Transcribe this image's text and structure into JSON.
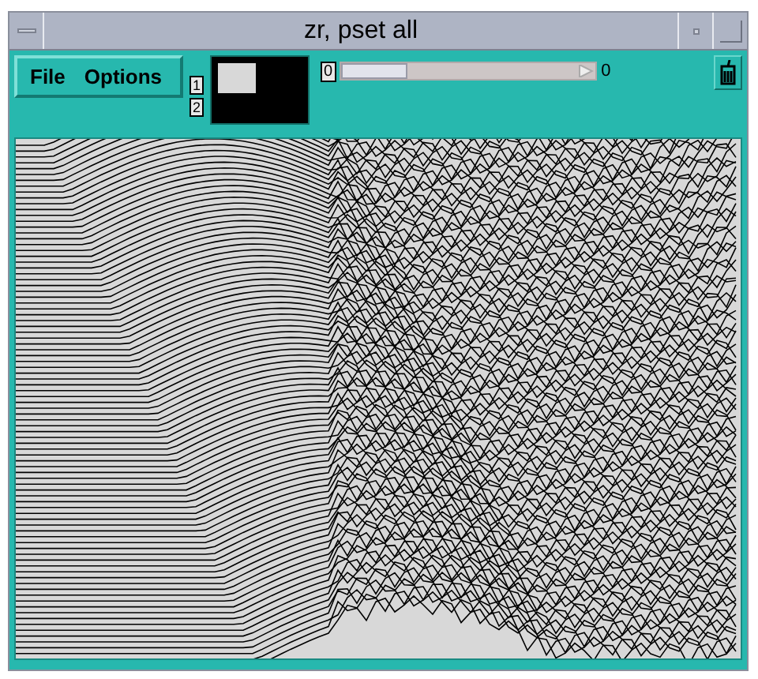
{
  "window": {
    "title": "zr, pset all"
  },
  "menu": [
    {
      "label": "File"
    },
    {
      "label": "Options"
    }
  ],
  "frame_buttons": [
    {
      "label": "1"
    },
    {
      "label": "2"
    }
  ],
  "slider": {
    "label": "0",
    "level": 0,
    "reading": "0"
  }
}
